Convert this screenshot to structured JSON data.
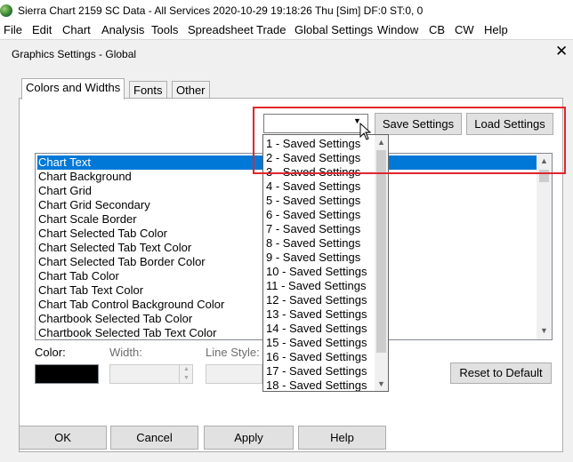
{
  "window": {
    "title": "Sierra Chart 2159 SC Data - All Services 2020-10-29  19:18:26 Thu [Sim]  DF:0  ST:0, 0"
  },
  "menu": [
    "File",
    "Edit",
    "Chart",
    "Analysis",
    "Tools",
    "Spreadsheet",
    "Trade",
    "Global Settings",
    "Window",
    "CB",
    "CW",
    "Help"
  ],
  "dialog": {
    "title": "Graphics Settings - Global",
    "close_symbol": "✕",
    "tabs": [
      "Colors and Widths",
      "Fonts",
      "Other"
    ],
    "save_label": "Save Settings",
    "load_label": "Load Settings",
    "combo_value": "",
    "list_items": [
      "Chart Text",
      "Chart Background",
      "Chart Grid",
      "Chart Grid Secondary",
      "Chart Scale Border",
      "Chart Selected Tab Color",
      "Chart Selected Tab Text Color",
      "Chart Selected Tab Border Color",
      "Chart Tab Color",
      "Chart Tab Text Color",
      "Chart Tab Control Background Color",
      "Chartbook Selected Tab Color",
      "Chartbook Selected Tab Text Color"
    ],
    "selected_item": "Chart Text",
    "dropdown_items": [
      "1 - Saved Settings",
      "2 - Saved Settings",
      "3 - Saved Settings",
      "4 - Saved Settings",
      "5 - Saved Settings",
      "6 - Saved Settings",
      "7 - Saved Settings",
      "8 - Saved Settings",
      "9 - Saved Settings",
      "10 - Saved Settings",
      "11 - Saved Settings",
      "12 - Saved Settings",
      "13 - Saved Settings",
      "14 - Saved Settings",
      "15 - Saved Settings",
      "16 - Saved Settings",
      "17 - Saved Settings",
      "18 - Saved Settings"
    ],
    "color_label": "Color:",
    "width_label": "Width:",
    "line_style_label": "Line Style:",
    "reset_label": "Reset to Default",
    "current_color": "#000000",
    "buttons": {
      "ok": "OK",
      "cancel": "Cancel",
      "apply": "Apply",
      "help": "Help"
    }
  },
  "colors": {
    "selection": "#0078d7",
    "highlight_box": "#e0262d"
  }
}
